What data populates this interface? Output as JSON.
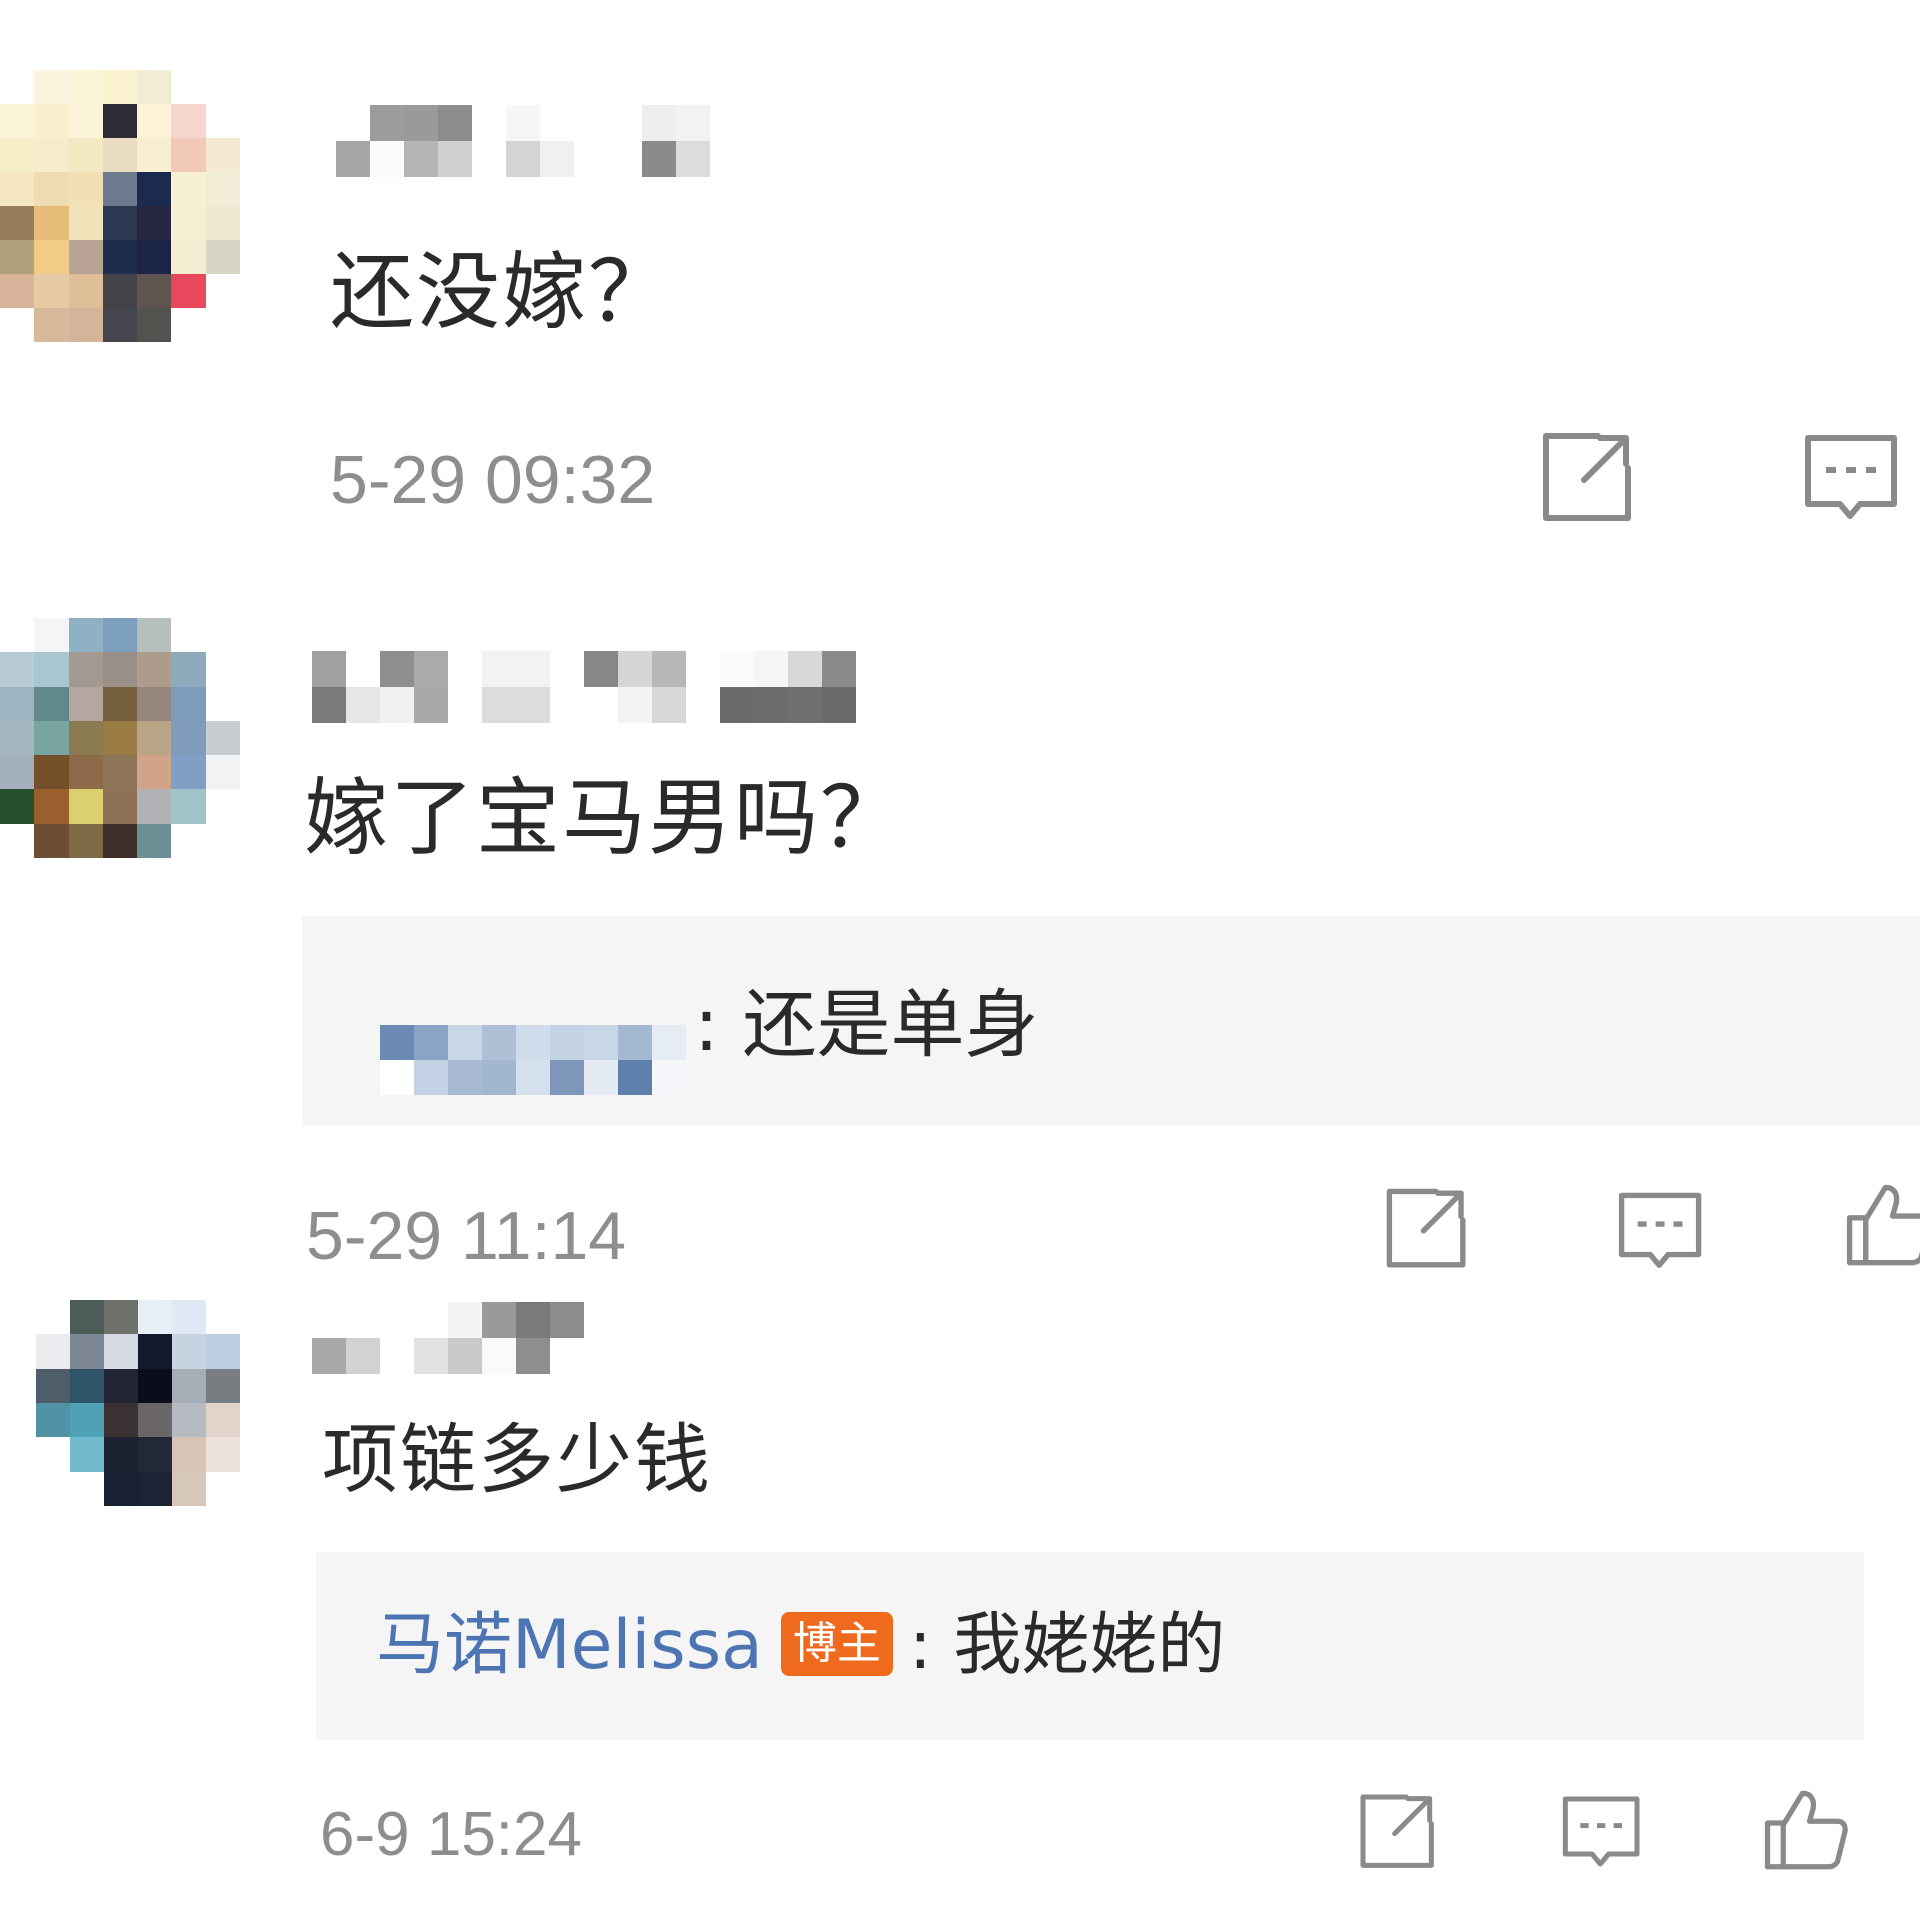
{
  "comments": [
    {
      "content": "还没嫁？",
      "time": "5-29 09:32",
      "actions": {
        "share": "share-icon",
        "reply": "comment-icon"
      }
    },
    {
      "content": "嫁了宝马男吗？",
      "reply": {
        "separator": ": ",
        "text": "还是单身"
      },
      "time": "5-29 11:14",
      "actions": {
        "share": "share-icon",
        "reply": "comment-icon",
        "like": "thumbs-up-icon"
      }
    },
    {
      "content": "项链多少钱",
      "reply": {
        "user": "马诺Melissa",
        "badge": "博主",
        "separator": ": ",
        "text": "我姥姥的"
      },
      "time": "6-9 15:24",
      "actions": {
        "share": "share-icon",
        "reply": "comment-icon",
        "like": "thumbs-up-icon"
      }
    }
  ],
  "colors": {
    "badge": "#f06a1d",
    "reply_user": "#4d75b4",
    "time": "#8e8e8e",
    "reply_bg": "#f5f5f5"
  }
}
